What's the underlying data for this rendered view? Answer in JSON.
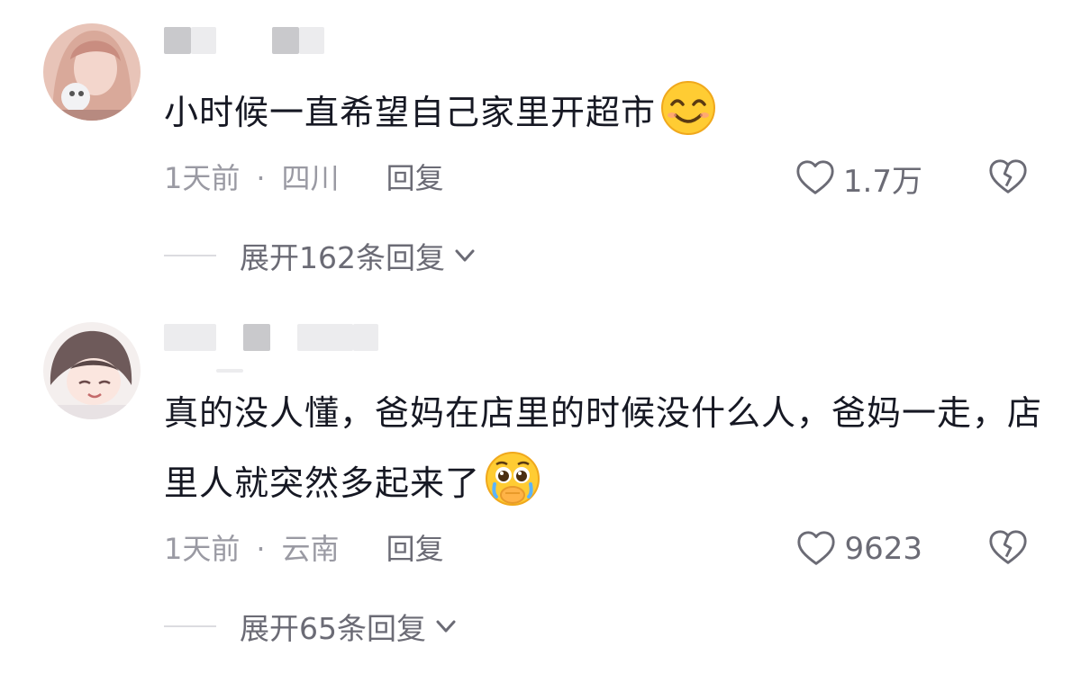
{
  "comments": [
    {
      "text": "小时候一直希望自己家里开超市",
      "emoji_icon": "smile-emoji-icon",
      "time": "1天前",
      "location": "四川",
      "reply_label": "回复",
      "likes": "1.7万",
      "expand_label": "展开162条回复"
    },
    {
      "text": "真的没人懂，爸妈在店里的时候没什么人，爸妈一走，店里人就突然多起来了",
      "emoji_icon": "pleading-emoji-icon",
      "time": "1天前",
      "location": "云南",
      "reply_label": "回复",
      "likes": "9623",
      "expand_label": "展开65条回复"
    }
  ],
  "separator": "·",
  "colors": {
    "meta": "#9a9aa3",
    "action": "#6b6b75",
    "text": "#161823"
  }
}
